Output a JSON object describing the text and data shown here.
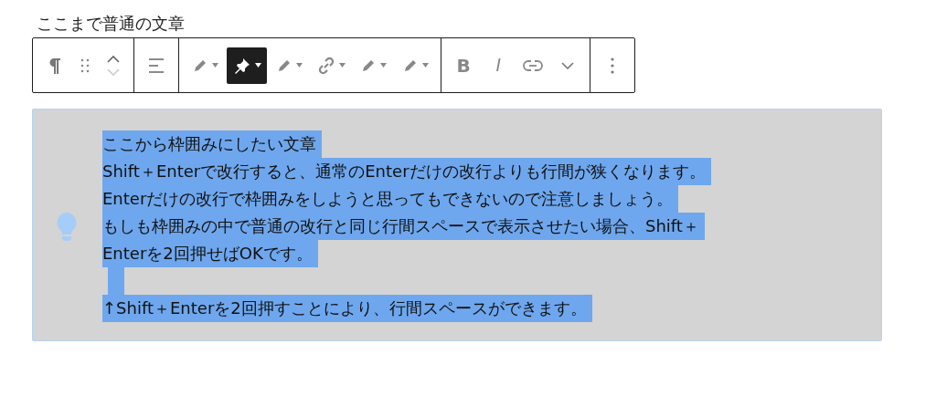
{
  "heading_text": "ここまで普通の文章",
  "toolbar": {
    "groups": [
      {
        "items": [
          {
            "kind": "pilcrow"
          },
          {
            "kind": "drag"
          },
          {
            "kind": "mover"
          }
        ]
      },
      {
        "items": [
          {
            "kind": "align"
          }
        ]
      },
      {
        "items": [
          {
            "kind": "pencil-dropdown",
            "selected": false
          },
          {
            "kind": "pin-dropdown",
            "selected": true
          },
          {
            "kind": "pencil-dropdown",
            "selected": false
          },
          {
            "kind": "link-dropdown",
            "selected": false
          },
          {
            "kind": "pencil-dropdown",
            "selected": false
          },
          {
            "kind": "pencil-dropdown",
            "selected": false
          }
        ]
      },
      {
        "items": [
          {
            "kind": "bold",
            "label": "B"
          },
          {
            "kind": "italic",
            "label": "I"
          },
          {
            "kind": "link"
          },
          {
            "kind": "chevron"
          }
        ]
      },
      {
        "items": [
          {
            "kind": "more"
          }
        ]
      }
    ]
  },
  "callout": {
    "lines": [
      {
        "kind": "text",
        "text": "ここから枠囲みにしたい文章"
      },
      {
        "kind": "text",
        "text": "Shift＋Enterで改行すると、通常のEnterだけの改行よりも行間が狭くなります。"
      },
      {
        "kind": "text",
        "text": "Enterだけの改行で枠囲みをしようと思ってもできないので注意しましょう。"
      },
      {
        "kind": "text",
        "text": "もしも枠囲みの中で普通の改行と同じ行間スペースで表示させたい場合、Shift＋"
      },
      {
        "kind": "text",
        "text": "Enterを2回押せばOKです。"
      },
      {
        "kind": "blank"
      },
      {
        "kind": "text",
        "text": "↑Shift＋Enterを2回押すことにより、行間スペースができます。"
      }
    ]
  }
}
